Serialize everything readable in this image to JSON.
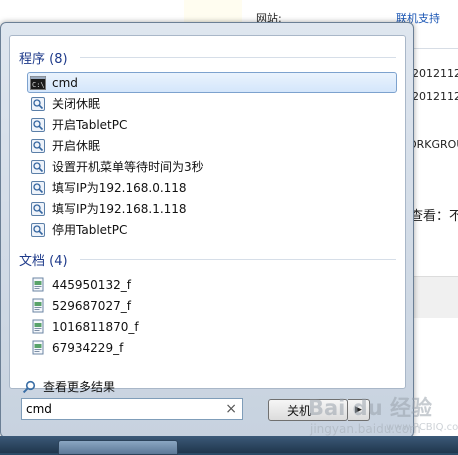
{
  "background_window": {
    "website_label": "网站:",
    "support_link": "联机支持",
    "date_1": "-2012112",
    "date_2": "-2012112",
    "workgroup": "ORKGROU",
    "view_label": "查看：不"
  },
  "start_menu": {
    "programs": {
      "header": "程序 (8)",
      "items": [
        {
          "label": "cmd",
          "icon": "cmd-icon",
          "selected": true
        },
        {
          "label": "关闭休眠",
          "icon": "script-icon"
        },
        {
          "label": "开启TabletPC",
          "icon": "script-icon"
        },
        {
          "label": "开启休眠",
          "icon": "script-icon"
        },
        {
          "label": "设置开机菜单等待时间为3秒",
          "icon": "script-icon"
        },
        {
          "label": "填写IP为192.168.0.118",
          "icon": "script-icon"
        },
        {
          "label": "填写IP为192.168.1.118",
          "icon": "script-icon"
        },
        {
          "label": "停用TabletPC",
          "icon": "script-icon"
        }
      ]
    },
    "documents": {
      "header": "文档 (4)",
      "items": [
        {
          "label": "445950132_f",
          "icon": "document-icon"
        },
        {
          "label": "529687027_f",
          "icon": "document-icon"
        },
        {
          "label": "1016811870_f",
          "icon": "document-icon"
        },
        {
          "label": "67934229_f",
          "icon": "document-icon"
        }
      ]
    },
    "more_results": "查看更多结果",
    "search": {
      "value": "cmd",
      "clear_glyph": "×"
    },
    "shutdown_label": "关机"
  },
  "watermark": {
    "text": "Bai du 经验",
    "sub": "jingyan.baidu.com",
    "url": "www.PCBIQ.com"
  },
  "colors": {
    "accent": "#1e3a8a",
    "selection": "#d4e6fb",
    "link": "#1a56b5"
  }
}
